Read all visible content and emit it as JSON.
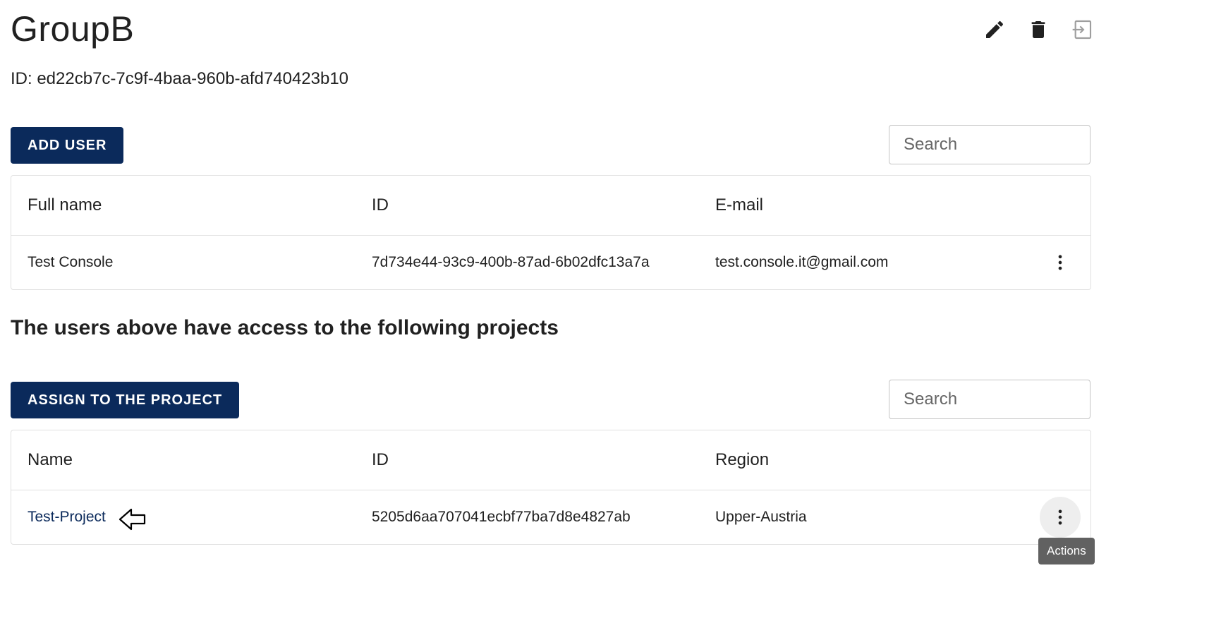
{
  "group": {
    "title": "GroupB",
    "id_line": "ID: ed22cb7c-7c9f-4baa-960b-afd740423b10"
  },
  "header_actions": {
    "edit_icon": "pencil-icon",
    "delete_icon": "trash-icon",
    "leave_icon": "exit-icon"
  },
  "users": {
    "add_button": "ADD USER",
    "search_placeholder": "Search",
    "columns": [
      "Full name",
      "ID",
      "E-mail"
    ],
    "rows": [
      {
        "full_name": "Test Console",
        "id": "7d734e44-93c9-400b-87ad-6b02dfc13a7a",
        "email": "test.console.it@gmail.com"
      }
    ]
  },
  "projects": {
    "heading": "The users above have access to the following projects",
    "assign_button": "ASSIGN TO THE PROJECT",
    "search_placeholder": "Search",
    "columns": [
      "Name",
      "ID",
      "Region"
    ],
    "rows": [
      {
        "name": "Test-Project",
        "id": "5205d6aa707041ecbf77ba7d8e4827ab",
        "region": "Upper-Austria"
      }
    ]
  },
  "tooltip": {
    "text": "Actions"
  },
  "colors": {
    "primary": "#0b2a5b",
    "tooltip_bg": "#616161"
  }
}
